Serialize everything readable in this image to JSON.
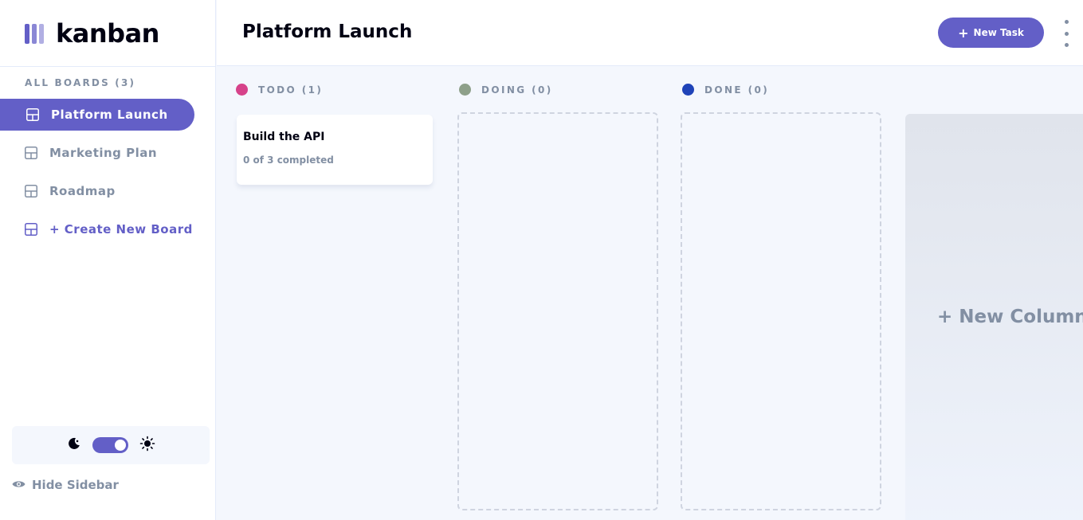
{
  "app": {
    "name": "kanban"
  },
  "sidebar": {
    "boards_heading": "ALL BOARDS (3)",
    "boards": [
      {
        "label": "Platform Launch",
        "active": true
      },
      {
        "label": "Marketing Plan",
        "active": false
      },
      {
        "label": "Roadmap",
        "active": false
      }
    ],
    "create_board_label": "+ Create New Board",
    "theme": {
      "mode": "dark",
      "toggle_on": true
    },
    "hide_label": "Hide Sidebar"
  },
  "header": {
    "title": "Platform Launch",
    "new_task_label": "New Task",
    "new_task_icon": "plus-icon",
    "menu_icon": "vertical-ellipsis-icon"
  },
  "columns": [
    {
      "label": "TODO (1)",
      "color": "#d6428a",
      "tasks": [
        {
          "title": "Build the API",
          "subtasks": "0 of 3 completed"
        }
      ]
    },
    {
      "label": "DOING (0)",
      "color": "#8ea08a",
      "tasks": []
    },
    {
      "label": "DONE (0)",
      "color": "#1f43b8",
      "tasks": []
    }
  ],
  "new_column_label": "+ New Column",
  "colors": {
    "accent": "#635fc7",
    "text_muted": "#828fa3",
    "background": "#f4f7fd"
  }
}
